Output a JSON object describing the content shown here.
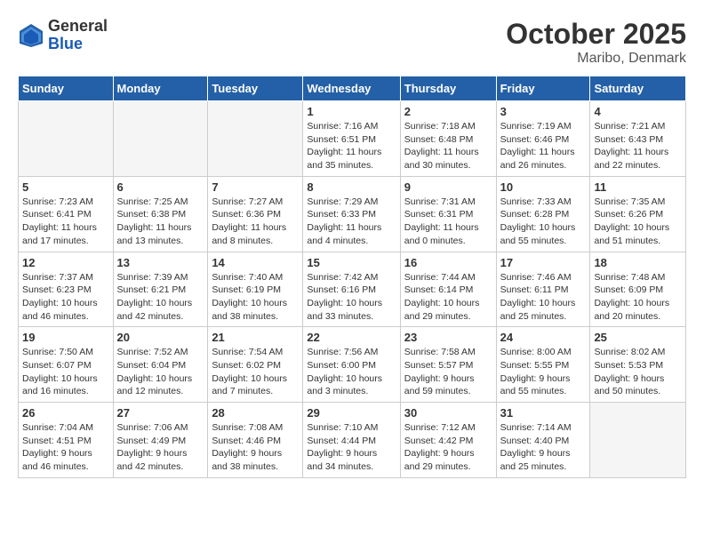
{
  "header": {
    "logo_general": "General",
    "logo_blue": "Blue",
    "month_title": "October 2025",
    "location": "Maribo, Denmark"
  },
  "days_of_week": [
    "Sunday",
    "Monday",
    "Tuesday",
    "Wednesday",
    "Thursday",
    "Friday",
    "Saturday"
  ],
  "weeks": [
    [
      {
        "num": "",
        "info": ""
      },
      {
        "num": "",
        "info": ""
      },
      {
        "num": "",
        "info": ""
      },
      {
        "num": "1",
        "info": "Sunrise: 7:16 AM\nSunset: 6:51 PM\nDaylight: 11 hours\nand 35 minutes."
      },
      {
        "num": "2",
        "info": "Sunrise: 7:18 AM\nSunset: 6:48 PM\nDaylight: 11 hours\nand 30 minutes."
      },
      {
        "num": "3",
        "info": "Sunrise: 7:19 AM\nSunset: 6:46 PM\nDaylight: 11 hours\nand 26 minutes."
      },
      {
        "num": "4",
        "info": "Sunrise: 7:21 AM\nSunset: 6:43 PM\nDaylight: 11 hours\nand 22 minutes."
      }
    ],
    [
      {
        "num": "5",
        "info": "Sunrise: 7:23 AM\nSunset: 6:41 PM\nDaylight: 11 hours\nand 17 minutes."
      },
      {
        "num": "6",
        "info": "Sunrise: 7:25 AM\nSunset: 6:38 PM\nDaylight: 11 hours\nand 13 minutes."
      },
      {
        "num": "7",
        "info": "Sunrise: 7:27 AM\nSunset: 6:36 PM\nDaylight: 11 hours\nand 8 minutes."
      },
      {
        "num": "8",
        "info": "Sunrise: 7:29 AM\nSunset: 6:33 PM\nDaylight: 11 hours\nand 4 minutes."
      },
      {
        "num": "9",
        "info": "Sunrise: 7:31 AM\nSunset: 6:31 PM\nDaylight: 11 hours\nand 0 minutes."
      },
      {
        "num": "10",
        "info": "Sunrise: 7:33 AM\nSunset: 6:28 PM\nDaylight: 10 hours\nand 55 minutes."
      },
      {
        "num": "11",
        "info": "Sunrise: 7:35 AM\nSunset: 6:26 PM\nDaylight: 10 hours\nand 51 minutes."
      }
    ],
    [
      {
        "num": "12",
        "info": "Sunrise: 7:37 AM\nSunset: 6:23 PM\nDaylight: 10 hours\nand 46 minutes."
      },
      {
        "num": "13",
        "info": "Sunrise: 7:39 AM\nSunset: 6:21 PM\nDaylight: 10 hours\nand 42 minutes."
      },
      {
        "num": "14",
        "info": "Sunrise: 7:40 AM\nSunset: 6:19 PM\nDaylight: 10 hours\nand 38 minutes."
      },
      {
        "num": "15",
        "info": "Sunrise: 7:42 AM\nSunset: 6:16 PM\nDaylight: 10 hours\nand 33 minutes."
      },
      {
        "num": "16",
        "info": "Sunrise: 7:44 AM\nSunset: 6:14 PM\nDaylight: 10 hours\nand 29 minutes."
      },
      {
        "num": "17",
        "info": "Sunrise: 7:46 AM\nSunset: 6:11 PM\nDaylight: 10 hours\nand 25 minutes."
      },
      {
        "num": "18",
        "info": "Sunrise: 7:48 AM\nSunset: 6:09 PM\nDaylight: 10 hours\nand 20 minutes."
      }
    ],
    [
      {
        "num": "19",
        "info": "Sunrise: 7:50 AM\nSunset: 6:07 PM\nDaylight: 10 hours\nand 16 minutes."
      },
      {
        "num": "20",
        "info": "Sunrise: 7:52 AM\nSunset: 6:04 PM\nDaylight: 10 hours\nand 12 minutes."
      },
      {
        "num": "21",
        "info": "Sunrise: 7:54 AM\nSunset: 6:02 PM\nDaylight: 10 hours\nand 7 minutes."
      },
      {
        "num": "22",
        "info": "Sunrise: 7:56 AM\nSunset: 6:00 PM\nDaylight: 10 hours\nand 3 minutes."
      },
      {
        "num": "23",
        "info": "Sunrise: 7:58 AM\nSunset: 5:57 PM\nDaylight: 9 hours\nand 59 minutes."
      },
      {
        "num": "24",
        "info": "Sunrise: 8:00 AM\nSunset: 5:55 PM\nDaylight: 9 hours\nand 55 minutes."
      },
      {
        "num": "25",
        "info": "Sunrise: 8:02 AM\nSunset: 5:53 PM\nDaylight: 9 hours\nand 50 minutes."
      }
    ],
    [
      {
        "num": "26",
        "info": "Sunrise: 7:04 AM\nSunset: 4:51 PM\nDaylight: 9 hours\nand 46 minutes."
      },
      {
        "num": "27",
        "info": "Sunrise: 7:06 AM\nSunset: 4:49 PM\nDaylight: 9 hours\nand 42 minutes."
      },
      {
        "num": "28",
        "info": "Sunrise: 7:08 AM\nSunset: 4:46 PM\nDaylight: 9 hours\nand 38 minutes."
      },
      {
        "num": "29",
        "info": "Sunrise: 7:10 AM\nSunset: 4:44 PM\nDaylight: 9 hours\nand 34 minutes."
      },
      {
        "num": "30",
        "info": "Sunrise: 7:12 AM\nSunset: 4:42 PM\nDaylight: 9 hours\nand 29 minutes."
      },
      {
        "num": "31",
        "info": "Sunrise: 7:14 AM\nSunset: 4:40 PM\nDaylight: 9 hours\nand 25 minutes."
      },
      {
        "num": "",
        "info": ""
      }
    ]
  ]
}
